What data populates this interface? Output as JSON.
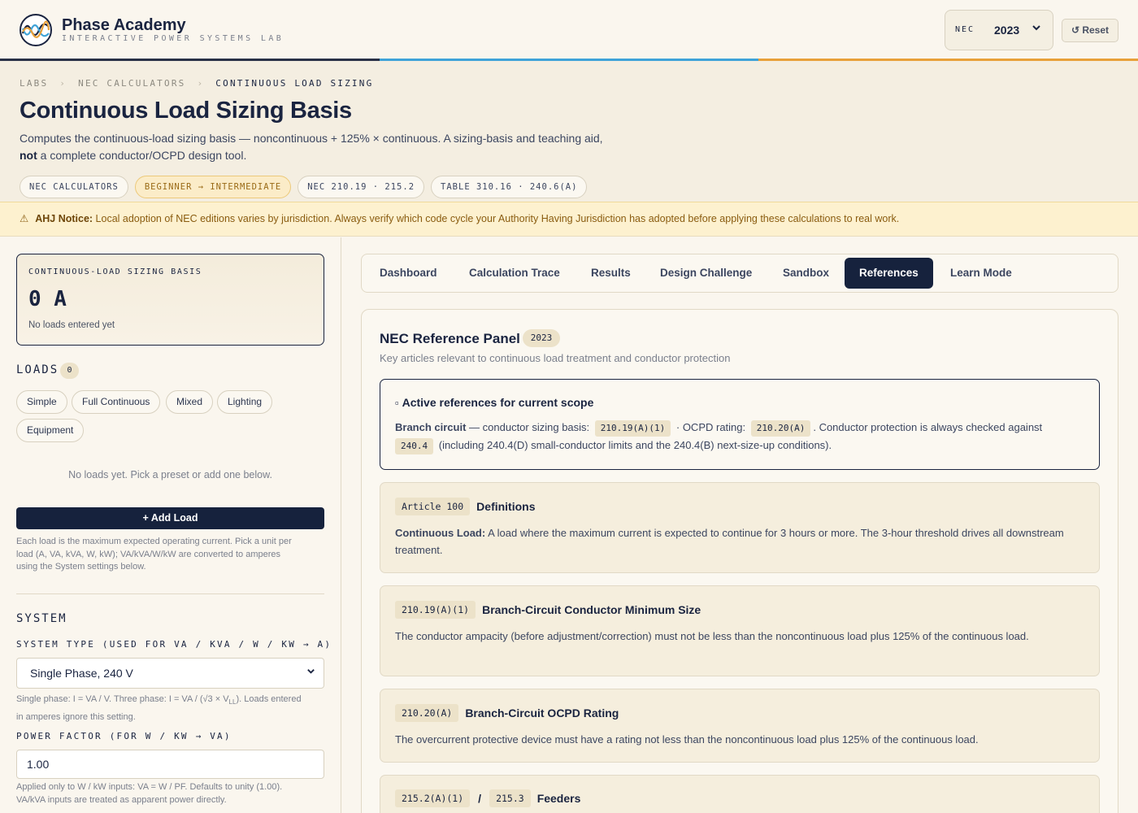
{
  "app": {
    "title": "Phase Academy",
    "subtitle": "INTERACTIVE POWER SYSTEMS LAB",
    "nec_label": "NEC",
    "nec_year": "2023",
    "reset_label": "↺ Reset",
    "phase_colors": [
      "#1a2440",
      "#3fa3d8",
      "#e8a13a"
    ]
  },
  "breadcrumb": [
    "LABS",
    "NEC CALCULATORS",
    "CONTINUOUS LOAD SIZING"
  ],
  "breadcrumb_sep": "›",
  "page": {
    "title": "Continuous Load Sizing Basis",
    "desc_line1": "Computes the continuous-load sizing basis — noncontinuous + 125% × continuous. A sizing-basis and teaching aid,",
    "desc_strong": "not",
    "desc_line2": " a complete conductor/OCPD design tool."
  },
  "tags": [
    "NEC CALCULATORS",
    "BEGINNER → INTERMEDIATE",
    "NEC 210.19 · 215.2",
    "TABLE 310.16 · 240.6(A)"
  ],
  "notice": {
    "icon": "⚠",
    "label": "AHJ Notice:",
    "text": " Local adoption of NEC editions varies by jurisdiction. Always verify which code cycle your Authority Having Jurisdiction has adopted before applying these calculations to real work."
  },
  "sidebar": {
    "basis_caption": "CONTINUOUS-LOAD SIZING BASIS",
    "basis_value": "0 A",
    "basis_note": "No loads entered yet",
    "loads_heading": "LOADS",
    "loads_count": "0",
    "presets": [
      "Simple",
      "Full Continuous",
      "Mixed",
      "Lighting",
      "Equipment"
    ],
    "empty_msg": "No loads yet. Pick a preset or add one below.",
    "add_label": "+ Add Load",
    "add_help_1": "Each load is the maximum expected operating current. Pick a unit per",
    "add_help_2": "load (A, VA, kVA, W, kW); VA/kVA/W/kW are converted to amperes",
    "add_help_3": "using the System settings below.",
    "system_heading": "SYSTEM",
    "system_type_label": "SYSTEM TYPE (USED FOR VA / KVA / W / KW → A)",
    "system_type_value": "Single Phase, 240 V",
    "system_help_1": "Single phase: I = VA / V. Three phase: I = VA / (√3 × V",
    "system_help_sub": "LL",
    "system_help_2": "). Loads entered",
    "system_help_3": "in amperes ignore this setting.",
    "pf_label": "POWER FACTOR (FOR W / KW → VA)",
    "pf_value": "1.00",
    "pf_help_1": "Applied only to W / kW inputs: VA = W / PF. Defaults to unity (1.00).",
    "pf_help_2": "VA/kVA inputs are treated as apparent power directly."
  },
  "tabs": [
    "Dashboard",
    "Calculation Trace",
    "Results",
    "Design Challenge",
    "Sandbox",
    "References",
    "Learn Mode"
  ],
  "active_tab": "References",
  "panel": {
    "title": "NEC Reference Panel",
    "year": "2023",
    "subtitle": "Key articles relevant to continuous load treatment and conductor protection",
    "active": {
      "icon": "▫",
      "title": "Active references for current scope",
      "lead": "Branch circuit",
      "t1": " — conductor sizing basis: ",
      "c1": "210.19(A)(1)",
      "t2": " · OCPD rating: ",
      "c2": "210.20(A)",
      "t3": ". Conductor protection is always checked against",
      "c3": "240.4",
      "t4": " (including 240.4(D) small-conductor limits and the 240.4(B) next-size-up conditions)."
    },
    "refs": [
      {
        "code": "Article 100",
        "title": "Definitions",
        "lead": "Continuous Load:",
        "text": " A load where the maximum current is expected to continue for 3 hours or more. The 3-hour threshold drives all downstream treatment."
      },
      {
        "code": "210.19(A)(1)",
        "title": "Branch-Circuit Conductor Minimum Size",
        "lead": "",
        "text": "The conductor ampacity (before adjustment/correction) must not be less than the noncontinuous load plus 125% of the continuous load."
      },
      {
        "code": "210.20(A)",
        "title": "Branch-Circuit OCPD Rating",
        "lead": "",
        "text": "The overcurrent protective device must have a rating not less than the noncontinuous load plus 125% of the continuous load."
      }
    ],
    "feeder": {
      "code_a": "215.2(A)(1)",
      "slash": "/",
      "code_b": "215.3",
      "title": "Feeders"
    }
  }
}
